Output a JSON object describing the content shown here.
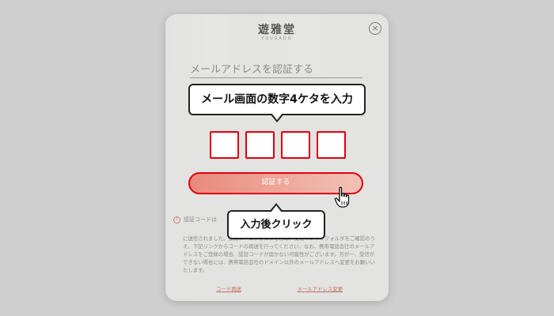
{
  "modal": {
    "logo": "遊雅堂",
    "logo_sub": "YUUGADO",
    "close_icon": "×",
    "heading": "メールアドレスを認証する",
    "code_boxes": [
      "",
      "",
      "",
      ""
    ],
    "verify_button": "認証する",
    "notice_icon": "!",
    "notice": "認証コードは",
    "body_text": "に送信されました。迷惑メールフォルダを含め、受信トレイやフォルダをご確認のうえ、下記リンクからコードの再送を行ってください。なお、携帯電話会社のメールアドレスをご登録の場合、認証コードが届かない可能性がございます。万が一、受信ができない場合には、携帯電話会社のドメイン以外のメールアドレスへ変更をお願いいたします。",
    "links": {
      "resend": "コード再送",
      "change_email": "メールアドレス変更"
    }
  },
  "annotations": {
    "top_callout": "メール画面の数字4ケタを入力",
    "bottom_callout": "入力後クリック"
  },
  "colors": {
    "accent_red": "#e0000f",
    "button_fill": "#e98a7b"
  },
  "icons": [
    "close-icon",
    "warning-icon",
    "hand-pointer-icon"
  ]
}
